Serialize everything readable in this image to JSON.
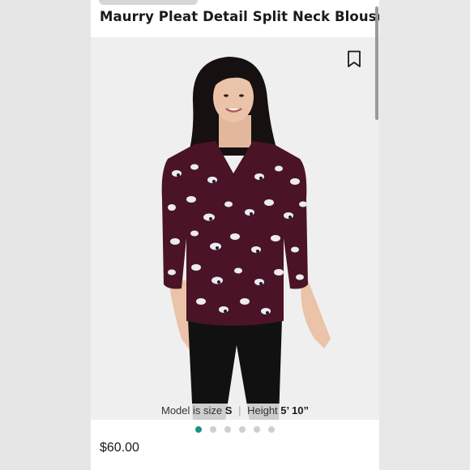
{
  "product": {
    "title": "Maurry Pleat Detail Split Neck Blouse",
    "price": "$60.00",
    "model_info": {
      "prefix": "Model is size",
      "size": "S",
      "height_label": "Height",
      "height": "5’ 10”"
    }
  },
  "gallery": {
    "total_images": 6,
    "active_index": 0,
    "indicator_active_color": "#1d8f8a",
    "indicator_inactive_color": "#cfcfcf"
  },
  "colors": {
    "blouse": "#4a1426",
    "pants": "#111111"
  },
  "icons": {
    "save": "bookmark-icon"
  }
}
